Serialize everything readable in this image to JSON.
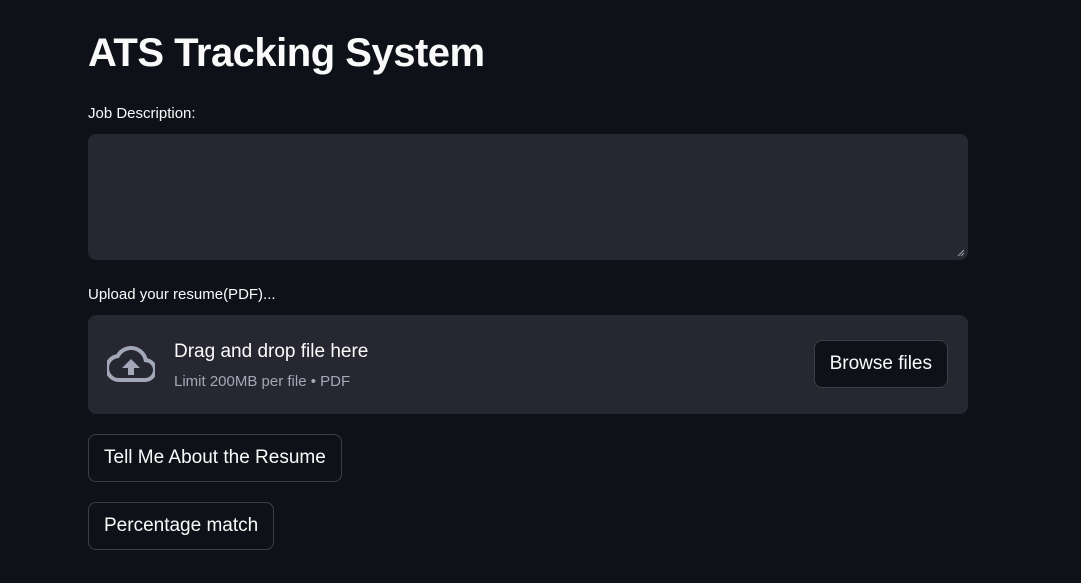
{
  "app": {
    "title": "ATS Tracking System"
  },
  "job_description": {
    "label": "Job Description:",
    "value": "",
    "placeholder": ""
  },
  "upload": {
    "label": "Upload your resume(PDF)...",
    "dropzone_text": "Drag and drop file here",
    "limit_text": "Limit 200MB per file • PDF",
    "browse_label": "Browse files",
    "icon": "cloud-upload-icon"
  },
  "actions": {
    "tell_me_label": "Tell Me About the Resume",
    "percentage_label": "Percentage match"
  },
  "colors": {
    "background": "#0e1117",
    "surface": "#262730",
    "text": "#fafafa",
    "muted_text": "#a3a8b8"
  }
}
